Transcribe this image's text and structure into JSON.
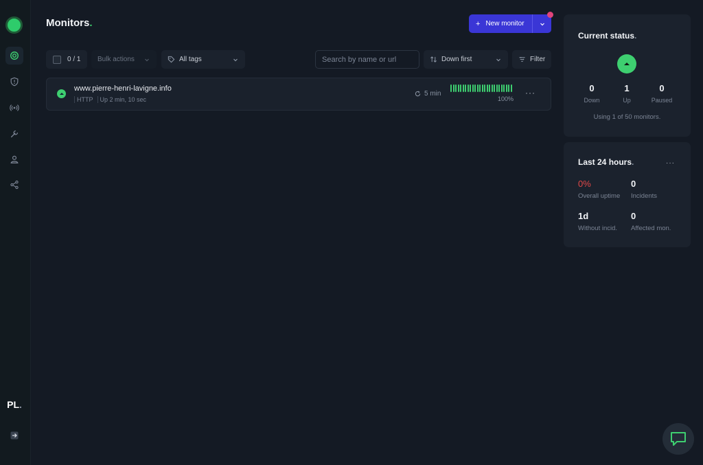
{
  "sidebar": {
    "avatar_initials": "PL",
    "avatar_dot": ".",
    "nav": [
      {
        "icon": "monitors-icon",
        "active": true
      },
      {
        "icon": "shield-icon"
      },
      {
        "icon": "broadcast-icon"
      },
      {
        "icon": "wrench-icon"
      },
      {
        "icon": "user-icon"
      },
      {
        "icon": "integrations-icon"
      }
    ]
  },
  "header": {
    "title": "Monitors",
    "title_dot": ".",
    "new_monitor_label": "New monitor"
  },
  "toolbar": {
    "selection_count": "0 / 1",
    "bulk_actions_label": "Bulk actions",
    "tags_label": "All tags",
    "search_placeholder": "Search by name or url",
    "sort_label": "Down first",
    "filter_label": "Filter"
  },
  "monitors": [
    {
      "url": "www.pierre-henri-lavigne.info",
      "type": "HTTP",
      "status_text": "Up 2 min, 10 sec",
      "interval": "5 min",
      "uptime": "100%",
      "status": "up"
    }
  ],
  "current_status": {
    "title": "Current status",
    "title_dot": ".",
    "down_count": "0",
    "down_label": "Down",
    "up_count": "1",
    "up_label": "Up",
    "paused_count": "0",
    "paused_label": "Paused",
    "usage_text": "Using 1 of 50 monitors."
  },
  "last_24h": {
    "title": "Last 24 hours",
    "title_dot": ".",
    "overall_uptime_value": "0%",
    "overall_uptime_label": "Overall uptime",
    "incidents_value": "0",
    "incidents_label": "Incidents",
    "without_incid_value": "1d",
    "without_incid_label": "Without incid.",
    "affected_value": "0",
    "affected_label": "Affected mon."
  },
  "colors": {
    "accent_green": "#3ecf70",
    "brand_blue": "#3a36d6",
    "danger_red": "#e04848",
    "notification_pink": "#e0447a"
  }
}
